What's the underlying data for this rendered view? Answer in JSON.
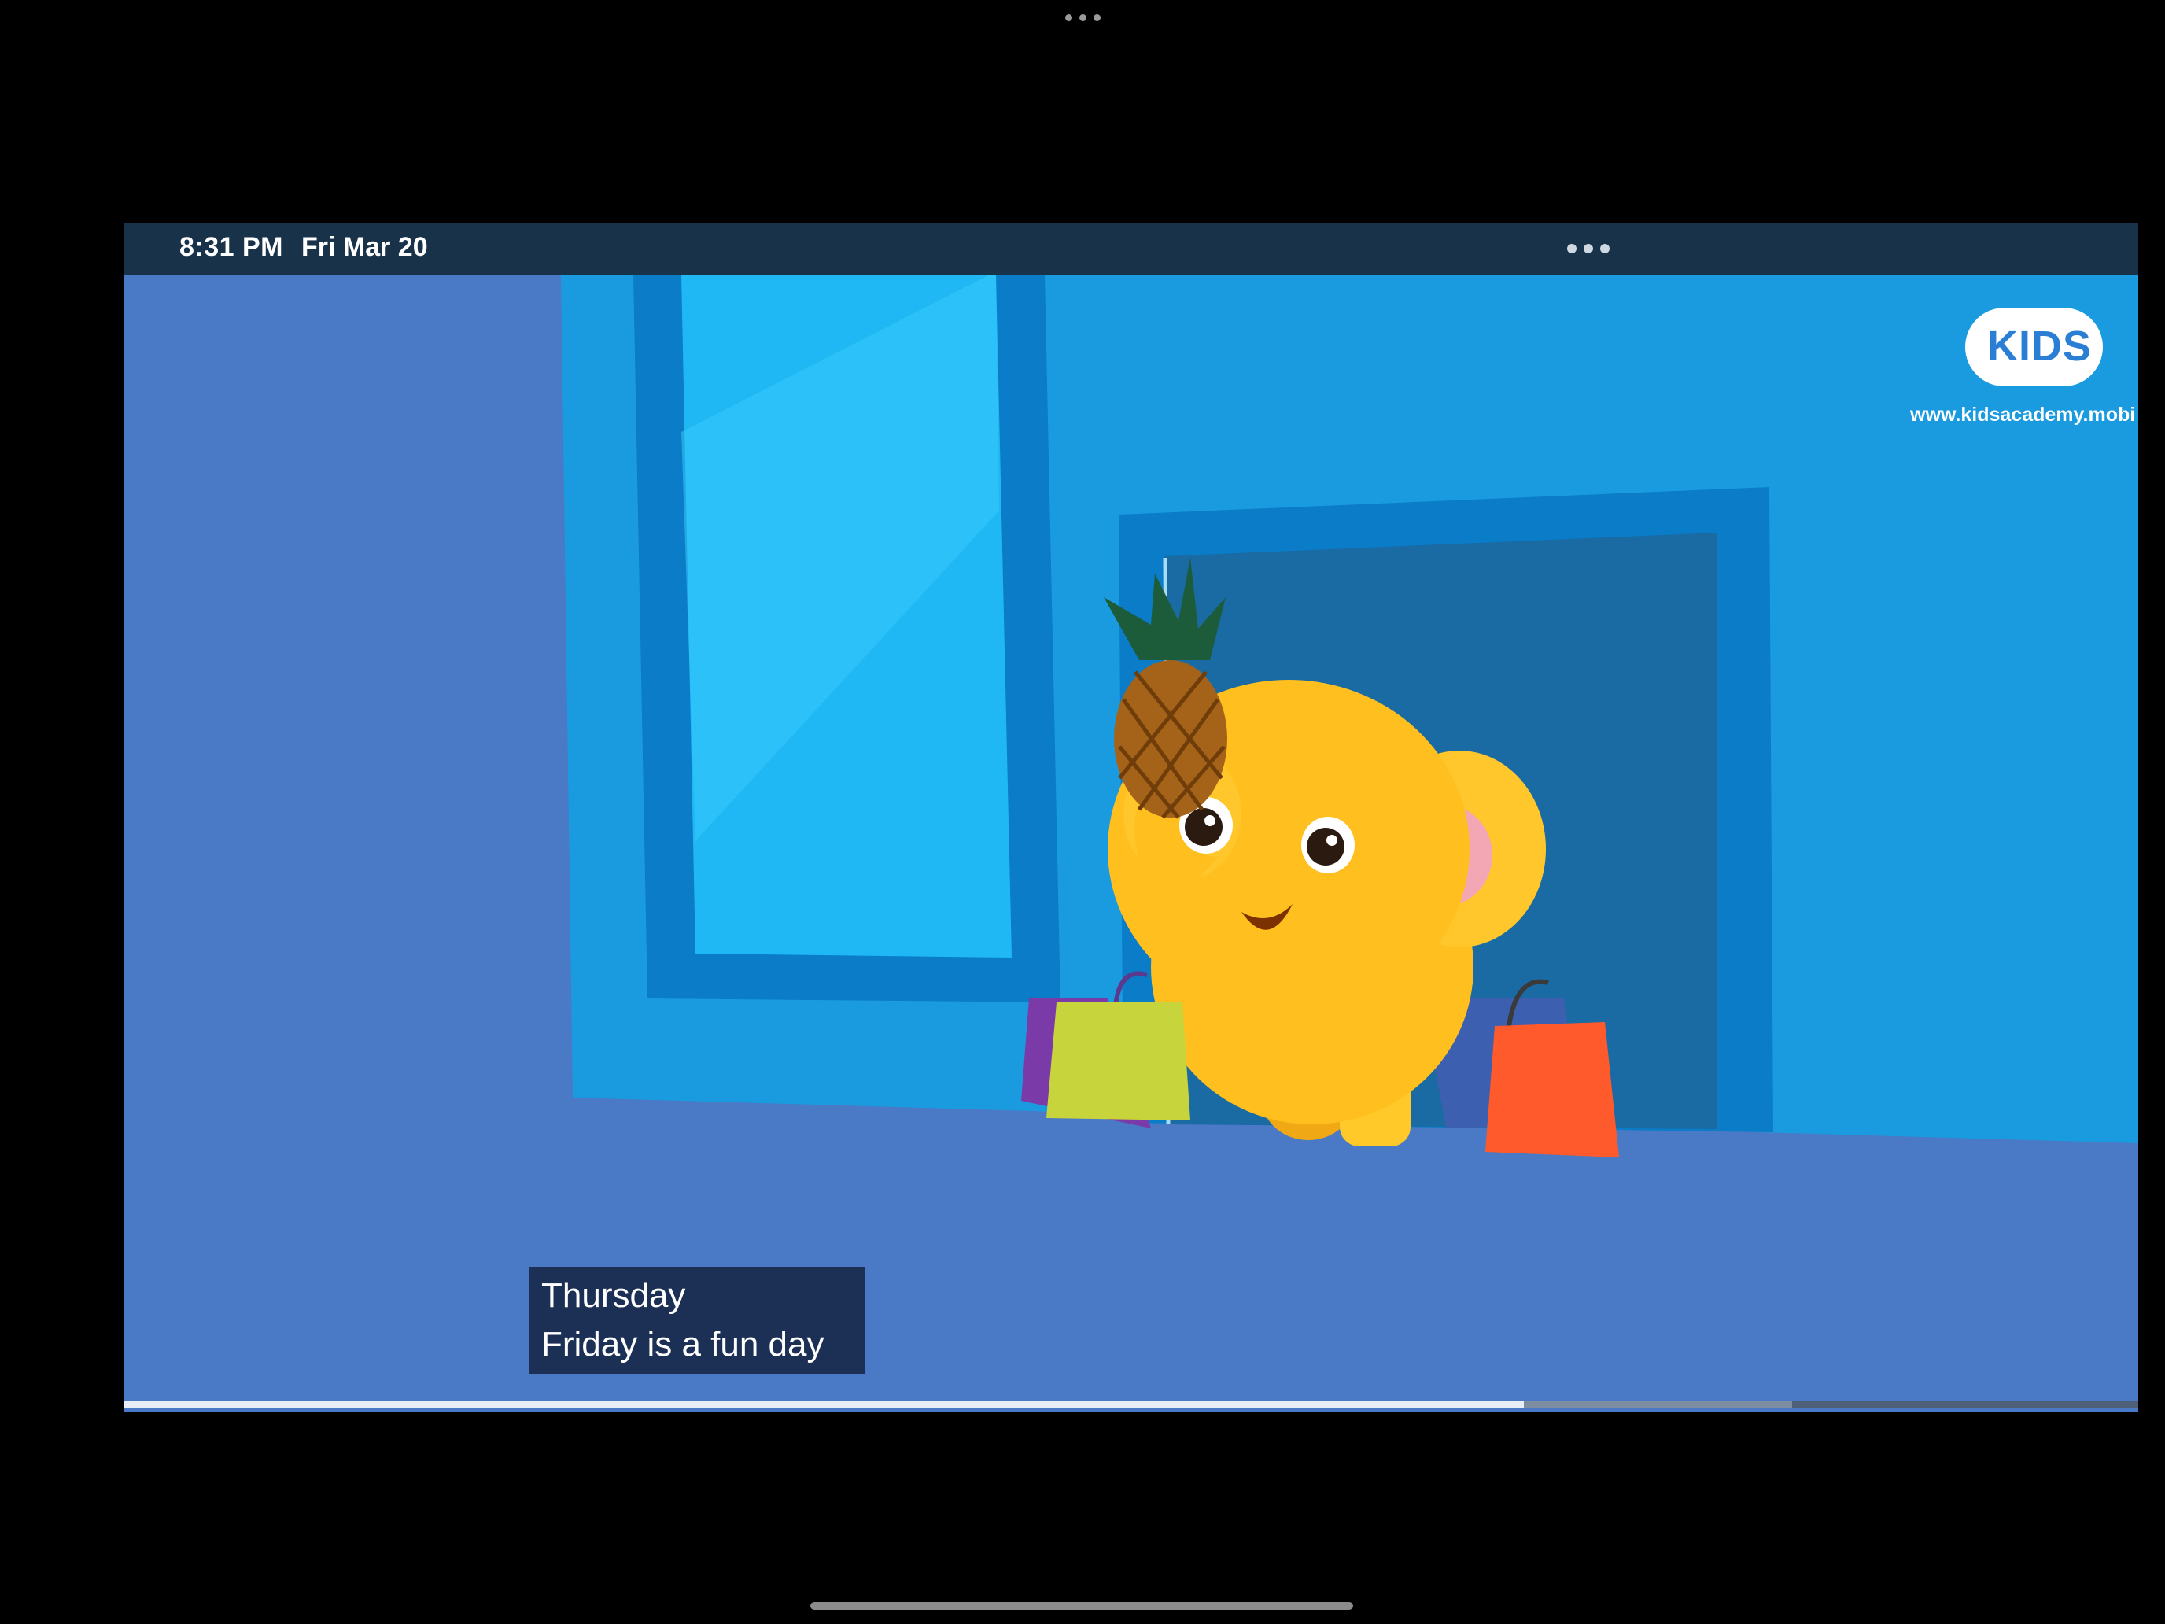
{
  "status_bar": {
    "time": "8:31 PM",
    "date": "Fri Mar 20"
  },
  "logo": {
    "text": "KIDS",
    "url_text": "www.kidsacademy.mobi"
  },
  "caption": {
    "line1": "Thursday",
    "line2": "Friday is a fun day"
  },
  "playback": {
    "progress": 0.695
  },
  "colors": {
    "wall": "#1a9be0",
    "floor": "#4a79c6",
    "elephant": "#ffbf1e",
    "status_bar": "#18324a",
    "caption_bg": "#1c2f55"
  }
}
